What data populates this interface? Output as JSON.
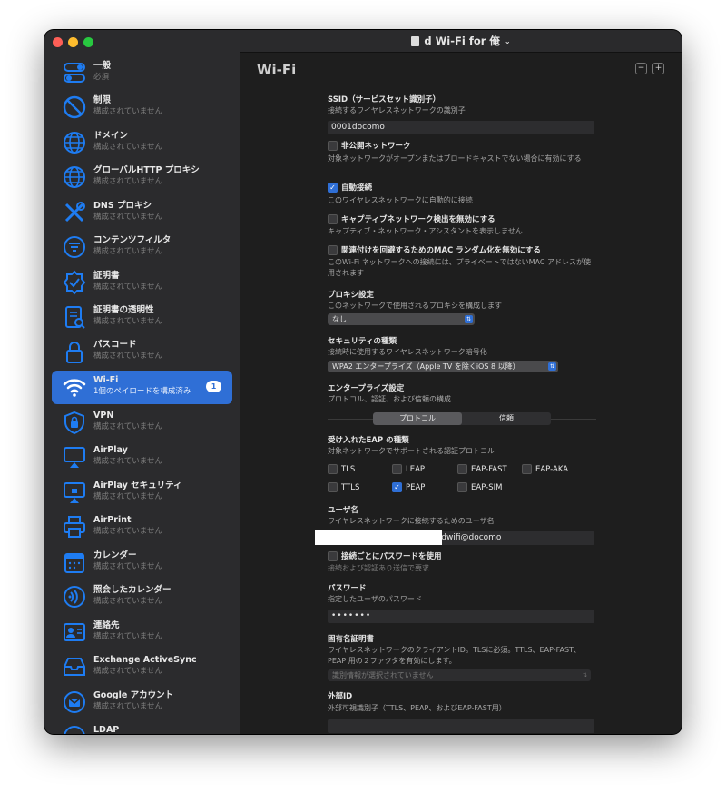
{
  "window": {
    "title": "d Wi-Fi for 俺"
  },
  "sidebar": {
    "items": [
      {
        "title": "一般",
        "subtitle": "必須"
      },
      {
        "title": "制限",
        "subtitle": "構成されていません"
      },
      {
        "title": "ドメイン",
        "subtitle": "構成されていません"
      },
      {
        "title": "グローバルHTTP プロキシ",
        "subtitle": "構成されていません"
      },
      {
        "title": "DNS プロキシ",
        "subtitle": "構成されていません"
      },
      {
        "title": "コンテンツフィルタ",
        "subtitle": "構成されていません"
      },
      {
        "title": "証明書",
        "subtitle": "構成されていません"
      },
      {
        "title": "証明書の透明性",
        "subtitle": "構成されていません"
      },
      {
        "title": "パスコード",
        "subtitle": "構成されていません"
      },
      {
        "title": "Wi-Fi",
        "subtitle": "1個のペイロードを構成済み",
        "badge": "1"
      },
      {
        "title": "VPN",
        "subtitle": "構成されていません"
      },
      {
        "title": "AirPlay",
        "subtitle": "構成されていません"
      },
      {
        "title": "AirPlay セキュリティ",
        "subtitle": "構成されていません"
      },
      {
        "title": "AirPrint",
        "subtitle": "構成されていません"
      },
      {
        "title": "カレンダー",
        "subtitle": "構成されていません"
      },
      {
        "title": "照会したカレンダー",
        "subtitle": "構成されていません"
      },
      {
        "title": "連絡先",
        "subtitle": "構成されていません"
      },
      {
        "title": "Exchange ActiveSync",
        "subtitle": "構成されていません"
      },
      {
        "title": "Google アカウント",
        "subtitle": "構成されていません"
      },
      {
        "title": "LDAP",
        "subtitle": ""
      }
    ]
  },
  "main": {
    "title": "Wi-Fi",
    "minus": "−",
    "plus": "+",
    "ssid": {
      "label": "SSID（サービスセット識別子）",
      "desc": "接続するワイヤレスネットワークの識別子",
      "value": "0001docomo"
    },
    "hidden": {
      "label": "非公開ネットワーク",
      "desc": "対象ネットワークがオープンまたはブロードキャストでない場合に有効にする",
      "checked": false
    },
    "auto": {
      "label": "自動接続",
      "desc": "このワイヤレスネットワークに自動的に接続",
      "checked": true
    },
    "captive": {
      "label": "キャプティブネットワーク検出を無効にする",
      "desc": "キャプティブ・ネットワーク・アシスタントを表示しません",
      "checked": false
    },
    "mac": {
      "label": "関連付けを回避するためのMAC ランダム化を無効にする",
      "desc": "このWi-Fi ネットワークへの接続には、プライベートではないMAC アドレスが使用されます",
      "checked": false
    },
    "proxy": {
      "label": "プロキシ設定",
      "desc": "このネットワークで使用されるプロキシを構成します",
      "value": "なし"
    },
    "security": {
      "label": "セキュリティの種類",
      "desc": "接続時に使用するワイヤレスネットワーク暗号化",
      "value": "WPA2 エンタープライズ（Apple TV を除くiOS 8 以降）"
    },
    "enterprise": {
      "label": "エンタープライズ設定",
      "desc": "プロトコル、認証、および信頼の構成",
      "tabs": [
        "プロトコル",
        "信頼"
      ]
    },
    "eap": {
      "label": "受け入れたEAP の種類",
      "desc": "対象ネットワークでサポートされる認証プロトコル",
      "options": [
        {
          "name": "TLS",
          "checked": false
        },
        {
          "name": "LEAP",
          "checked": false
        },
        {
          "name": "EAP-FAST",
          "checked": false
        },
        {
          "name": "EAP-AKA",
          "checked": false
        },
        {
          "name": "TTLS",
          "checked": false
        },
        {
          "name": "PEAP",
          "checked": true
        },
        {
          "name": "EAP-SIM",
          "checked": false
        }
      ]
    },
    "username": {
      "label": "ユーザ名",
      "desc": "ワイヤレスネットワークに接続するためのユーザ名",
      "value": "-dwifi@docomo"
    },
    "perconn": {
      "label": "接続ごとにパスワードを使用",
      "desc": "接続および認証あり送信で要求",
      "checked": false
    },
    "password": {
      "label": "パスワード",
      "desc": "指定したユーザのパスワード",
      "value": "•••••••"
    },
    "identity": {
      "label": "固有名証明書",
      "desc": "ワイヤレスネットワークのクライアントID。TLSに必須。TTLS、EAP-FAST、PEAP 用の２ファクタを有効にします。",
      "value": "識別情報が選択されていません"
    },
    "outer": {
      "label": "外部ID",
      "desc": "外部可視識別子（TTLS、PEAP、およびEAP-FAST用）",
      "value": ""
    }
  },
  "colors": {
    "accent": "#2f6fd6",
    "red": "#fe5f57",
    "yellow": "#febc2e",
    "green": "#28c840"
  }
}
